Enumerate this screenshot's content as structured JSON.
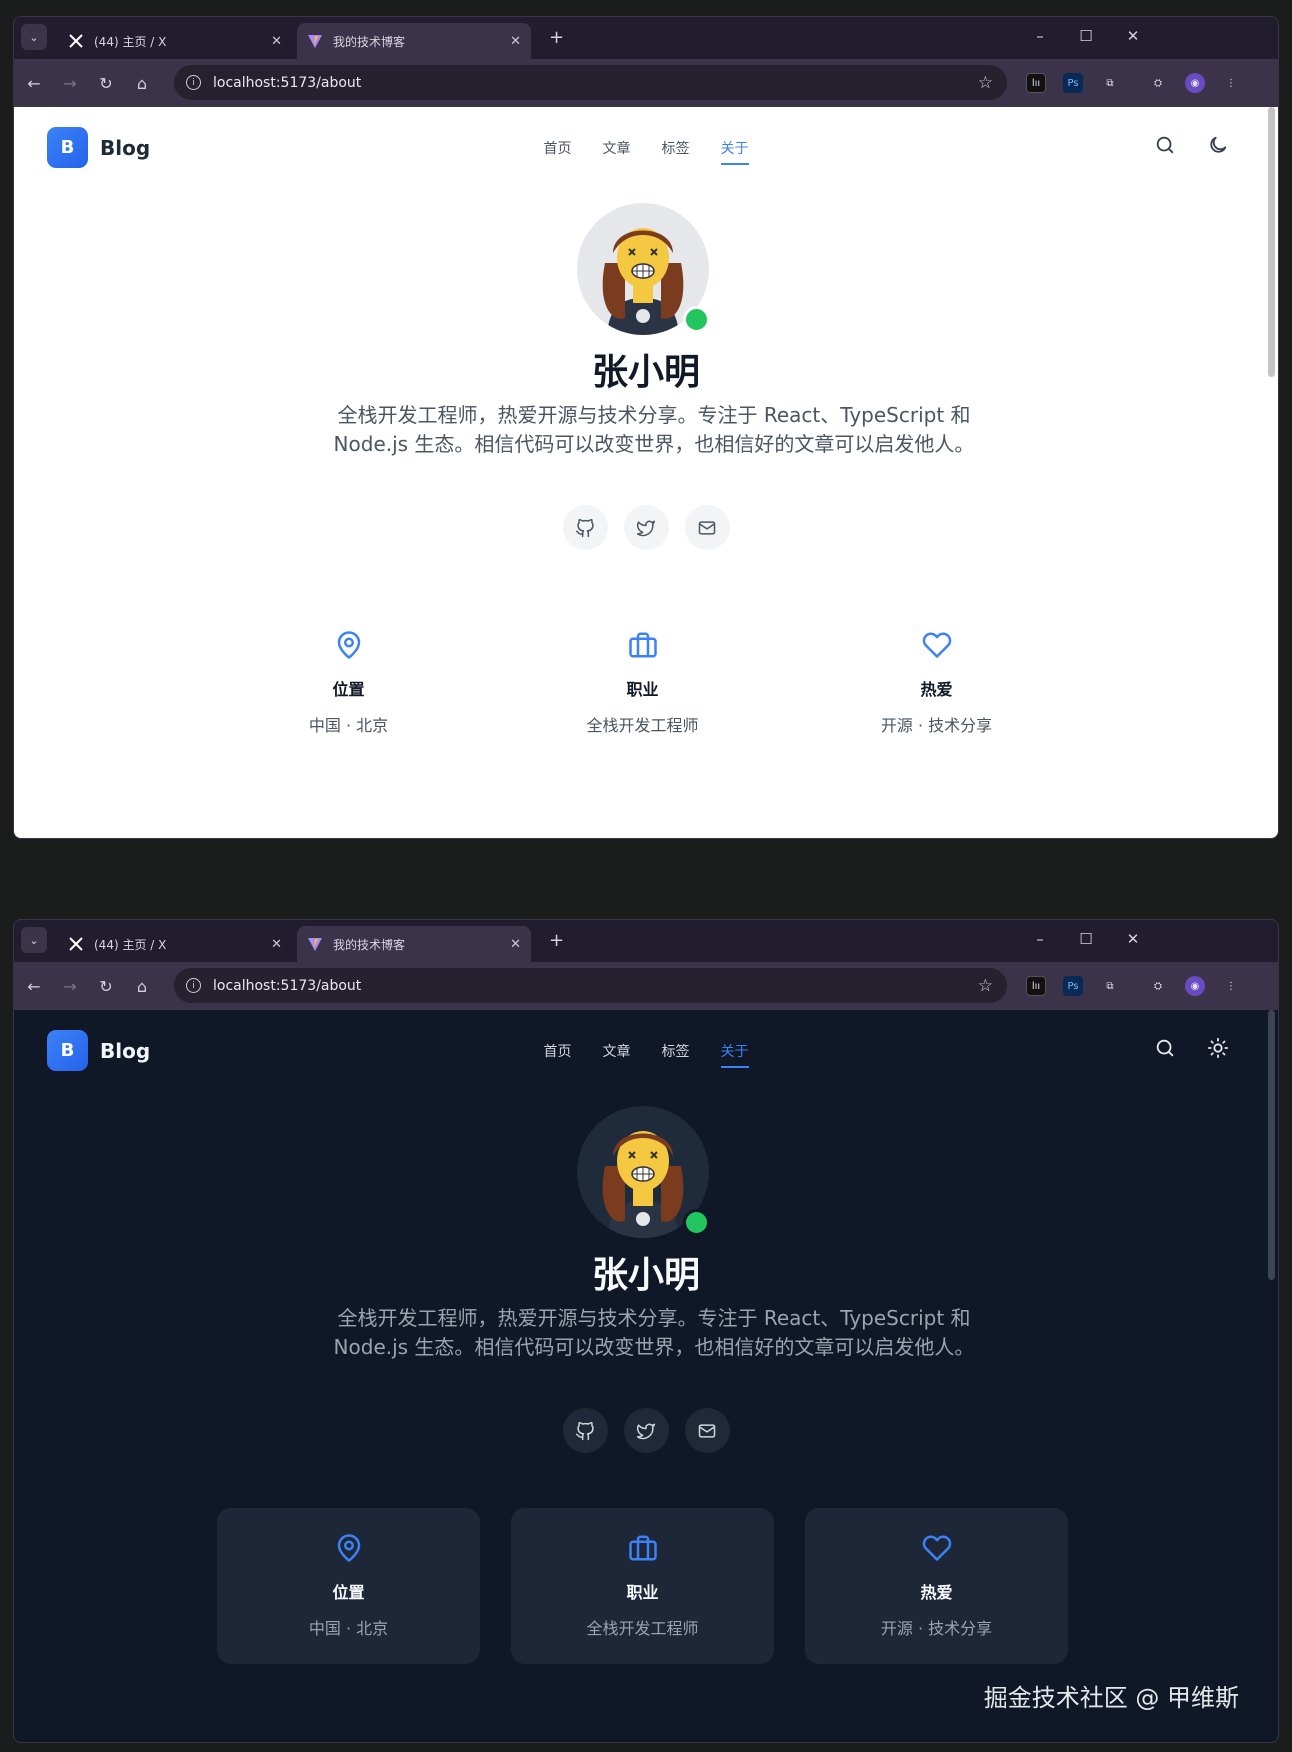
{
  "browser": {
    "tabs": [
      {
        "title": "(44) 主页 / X",
        "icon": "x-logo-icon"
      },
      {
        "title": "我的技术博客",
        "icon": "vite-logo-icon"
      }
    ],
    "url": "localhost:5173/about"
  },
  "site": {
    "logo_letter": "B",
    "logo_text": "Blog",
    "nav": [
      "首页",
      "文章",
      "标签",
      "关于"
    ],
    "active_nav": "关于",
    "theme_icon_light": "moon-icon",
    "theme_icon_dark": "sun-icon"
  },
  "profile": {
    "name": "张小明",
    "bio": "全栈开发工程师，热爱开源与技术分享。专注于 React、TypeScript 和 Node.js 生态。相信代码可以改变世界，也相信好的文章可以启发他人。",
    "socials": [
      "github-icon",
      "twitter-icon",
      "mail-icon"
    ],
    "online": true
  },
  "cards": [
    {
      "icon": "map-pin-icon",
      "title": "位置",
      "value": "中国 · 北京"
    },
    {
      "icon": "briefcase-icon",
      "title": "职业",
      "value": "全栈开发工程师"
    },
    {
      "icon": "heart-icon",
      "title": "热爱",
      "value": "开源 · 技术分享"
    }
  ],
  "watermark": "掘金技术社区 @ 甲维斯",
  "colors": {
    "accent": "#3b82f6",
    "online": "#22c55e",
    "dark_bg": "#101828"
  }
}
